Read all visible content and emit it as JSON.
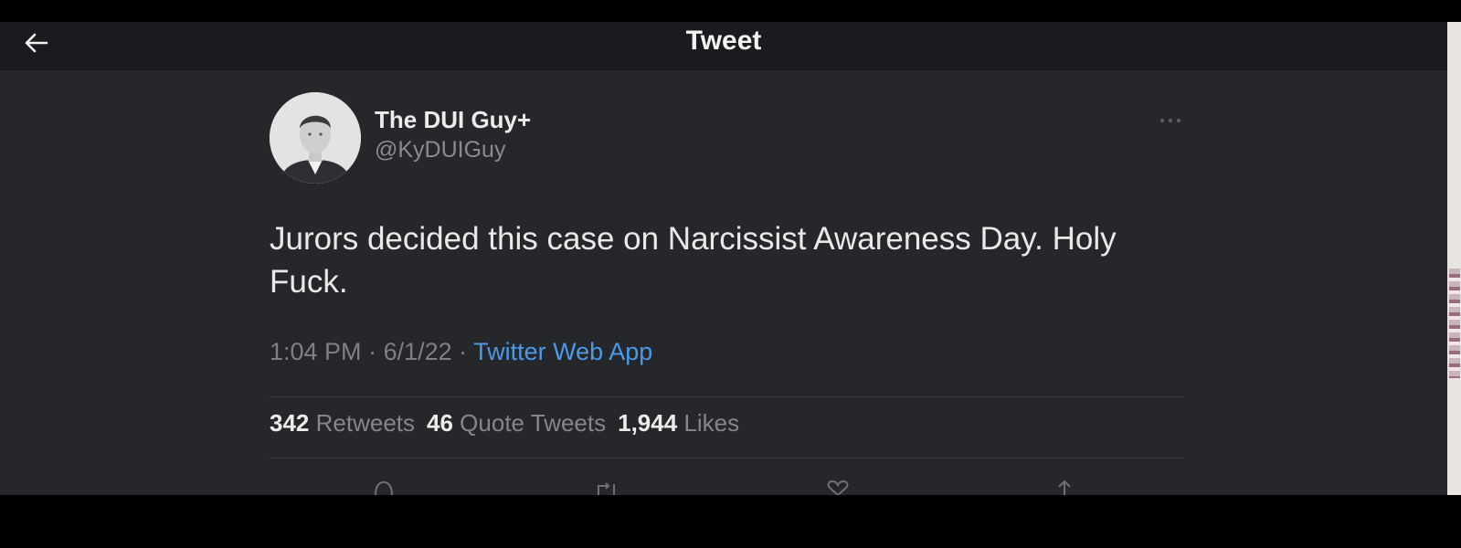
{
  "header": {
    "title": "Tweet",
    "back_icon": "arrow-left-icon"
  },
  "tweet": {
    "author": {
      "display_name": "The DUI Guy+",
      "handle": "@KyDUIGuy"
    },
    "text": "Jurors decided this case on Narcissist Awareness Day. Holy Fuck.",
    "time": "1:04 PM",
    "separator": " · ",
    "date": "6/1/22",
    "source": "Twitter Web App",
    "stats": {
      "retweets_count": "342",
      "retweets_label": "Retweets",
      "quotes_count": "46",
      "quotes_label": "Quote Tweets",
      "likes_count": "1,944",
      "likes_label": "Likes"
    },
    "action_icons": [
      "reply-icon",
      "retweet-icon",
      "like-icon",
      "share-icon"
    ]
  },
  "colors": {
    "background": "#26272b",
    "header_background": "#1a1b1e",
    "link": "#4a9ae8",
    "primary_text": "#e9e9ea",
    "secondary_text": "#7f8084"
  }
}
